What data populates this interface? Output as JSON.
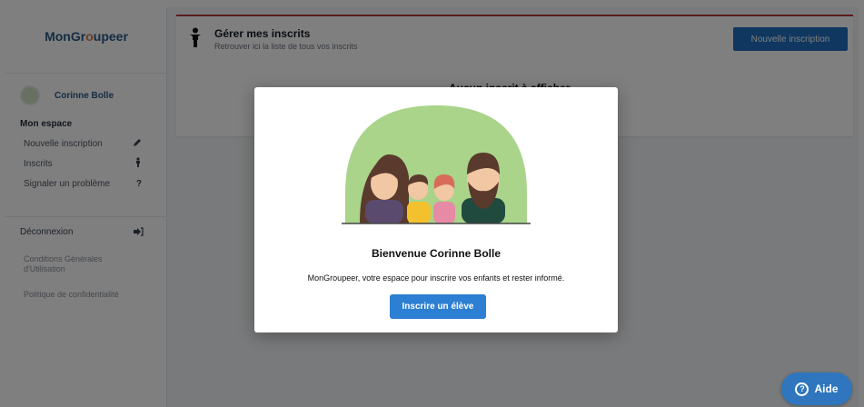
{
  "sidebar": {
    "logo_part1": "MonGr",
    "logo_accent": "o",
    "logo_part2": "upeer",
    "user_name": "Corinne Bolle",
    "section_title": "Mon espace",
    "items": [
      {
        "label": "Nouvelle inscription",
        "icon": "pencil-icon"
      },
      {
        "label": "Inscrits",
        "icon": "person-icon"
      },
      {
        "label": "Signaler un problème",
        "icon": "question-icon"
      }
    ],
    "logout_label": "Déconnexion",
    "terms_label_1": "Conditions Générales",
    "terms_label_2": "d'Utilisation",
    "privacy_label": "Politique de confidentialité"
  },
  "header": {
    "title": "Gérer mes inscrits",
    "subtitle": "Retrouver ici la liste de tous vos inscrits",
    "new_button": "Nouvelle inscription"
  },
  "main": {
    "empty_message": "Aucun inscrit à afficher"
  },
  "modal": {
    "title": "Bienvenue Corinne Bolle",
    "description": "MonGroupeer, votre espace pour inscrire vos enfants et rester informé.",
    "cta": "Inscrire un élève"
  },
  "help": {
    "label": "Aide"
  },
  "colors": {
    "primary": "#2c7fd2",
    "accent": "#e07a45",
    "header_border": "#b23b3b"
  }
}
